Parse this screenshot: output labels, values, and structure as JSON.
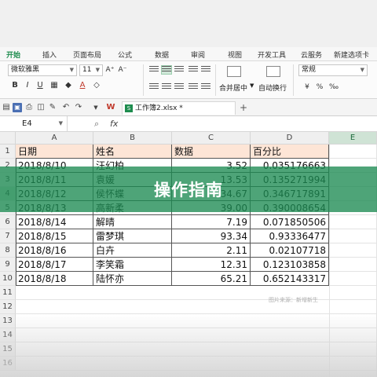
{
  "ribbon_tabs": [
    {
      "label": "开始",
      "active": true
    },
    {
      "label": "插入"
    },
    {
      "label": "页面布局"
    },
    {
      "label": "公式"
    },
    {
      "label": "数据"
    },
    {
      "label": "审阅"
    },
    {
      "label": "视图"
    },
    {
      "label": "开发工具"
    },
    {
      "label": "云服务"
    },
    {
      "label": "新建选项卡"
    }
  ],
  "ribbon": {
    "font_name": "微软雅黑",
    "font_size": "11",
    "number_format": "常规",
    "merge_center_label": "合并居中",
    "wrap_text_label": "自动换行",
    "bold": "B",
    "italic": "I",
    "underline": "U",
    "font_color_letter": "A",
    "grow_font": "A⁺",
    "shrink_font": "A⁻"
  },
  "document": {
    "file_tab_label": "工作簿2.xlsx *",
    "add_tab": "+"
  },
  "formula_bar": {
    "name_box": "E4",
    "fx_label": "fx",
    "value": ""
  },
  "grid": {
    "columns": [
      "A",
      "B",
      "C",
      "D",
      "E"
    ],
    "selected_column": "E",
    "row_numbers": [
      "1",
      "2",
      "3",
      "4",
      "5",
      "6",
      "7",
      "8",
      "9",
      "10",
      "11",
      "12",
      "13",
      "14",
      "15",
      "16"
    ],
    "selected_row": "4",
    "header_row": [
      "日期",
      "姓名",
      "数据",
      "百分比"
    ],
    "rows": [
      [
        "2018/8/10",
        "汪幻柏",
        "3.52",
        "0.035176663"
      ],
      [
        "2018/8/11",
        "袁媛",
        "13.53",
        "0.135271994"
      ],
      [
        "2018/8/12",
        "侯怀蝶",
        "34.67",
        "0.346717891"
      ],
      [
        "2018/8/13",
        "高新柔",
        "39.00",
        "0.390008654"
      ],
      [
        "2018/8/14",
        "解晴",
        "7.19",
        "0.071850506"
      ],
      [
        "2018/8/15",
        "雷梦琪",
        "93.34",
        "0.93336477"
      ],
      [
        "2018/8/16",
        "白卉",
        "2.11",
        "0.02107718"
      ],
      [
        "2018/8/17",
        "李笑霜",
        "12.31",
        "0.123103858"
      ],
      [
        "2018/8/18",
        "陆怀亦",
        "65.21",
        "0.652143317"
      ]
    ],
    "source_note": "图片来源：新增新生"
  },
  "banner": {
    "title": "操作指南",
    "color": "#1c8a52"
  },
  "colors": {
    "accent": "#1e8c4e",
    "header_fill": "#fde5d6"
  }
}
